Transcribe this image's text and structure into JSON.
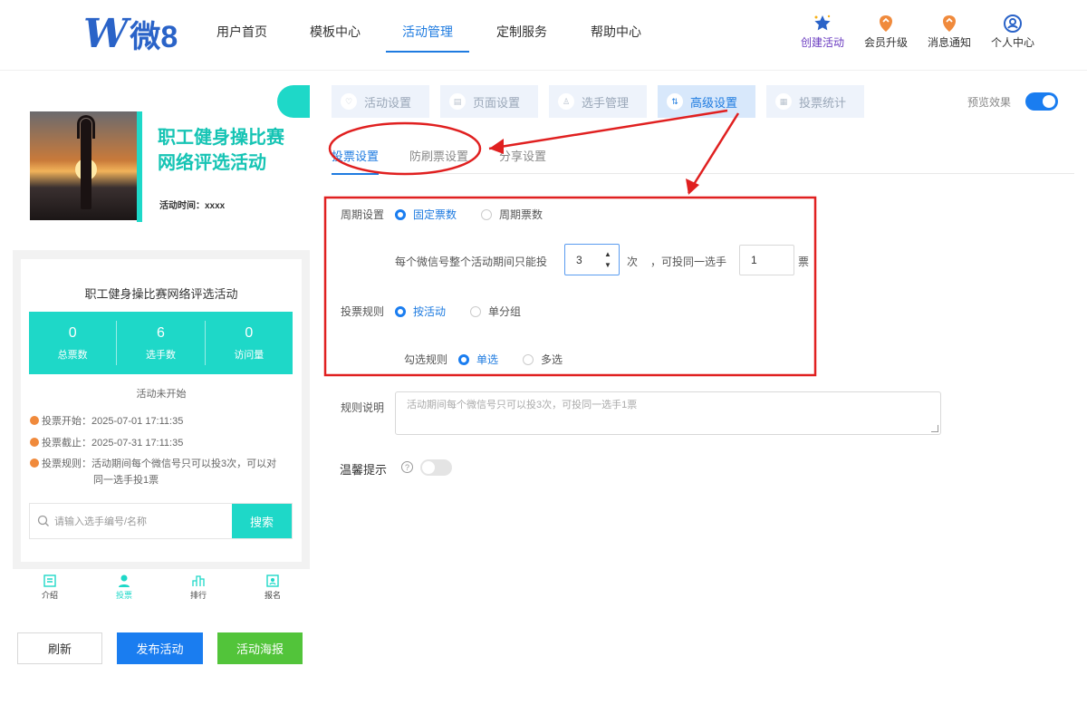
{
  "logo": {
    "mark": "W",
    "text": "微8"
  },
  "nav": {
    "items": [
      {
        "label": "用户首页"
      },
      {
        "label": "模板中心"
      },
      {
        "label": "活动管理"
      },
      {
        "label": "定制服务"
      },
      {
        "label": "帮助中心"
      }
    ],
    "active": "活动管理"
  },
  "header_icons": [
    {
      "label": "创建活动",
      "icon": "star-create-icon"
    },
    {
      "label": "会员升级",
      "icon": "member-upgrade-icon"
    },
    {
      "label": "消息通知",
      "icon": "notification-icon"
    },
    {
      "label": "个人中心",
      "icon": "user-center-icon"
    }
  ],
  "preview": {
    "banner_title_line1": "职工健身操比赛",
    "banner_title_line2": "网络评选活动",
    "activity_time": "活动时间：xxxx",
    "card_title": "职工健身操比赛网络评选活动",
    "stats": [
      {
        "value": "0",
        "label": "总票数"
      },
      {
        "value": "6",
        "label": "选手数"
      },
      {
        "value": "0",
        "label": "访问量"
      }
    ],
    "status": "活动未开始",
    "vote_start": "投票开始：2025-07-01 17:11:35",
    "vote_end": "投票截止：2025-07-31 17:11:35",
    "vote_rule_line1": "投票规则：活动期间每个微信号只可以投3次，可以对",
    "vote_rule_line2": "同一选手投1票",
    "search_placeholder": "请输入选手编号/名称",
    "search_button": "搜索",
    "tabbar": [
      {
        "label": "介绍",
        "icon": "intro-icon"
      },
      {
        "label": "投票",
        "icon": "vote-user-icon"
      },
      {
        "label": "排行",
        "icon": "ranking-icon"
      },
      {
        "label": "报名",
        "icon": "signup-icon"
      }
    ]
  },
  "actions": {
    "refresh": "刷新",
    "publish": "发布活动",
    "poster": "活动海报"
  },
  "top_tabs": [
    {
      "label": "活动设置",
      "icon": "heart-icon"
    },
    {
      "label": "页面设置",
      "icon": "page-icon"
    },
    {
      "label": "选手管理",
      "icon": "person-icon"
    },
    {
      "label": "高级设置",
      "icon": "settings-sliders-icon"
    },
    {
      "label": "投票统计",
      "icon": "stats-icon"
    }
  ],
  "active_top_tab": "高级设置",
  "preview_toggle": {
    "label": "预览效果",
    "on": true
  },
  "sub_tabs": [
    {
      "label": "投票设置"
    },
    {
      "label": "防刷票设置"
    },
    {
      "label": "分享设置"
    }
  ],
  "form": {
    "cycle_label": "周期设置",
    "cycle_options": [
      "固定票数",
      "周期票数"
    ],
    "cycle_selected": "固定票数",
    "limit_prefix": "每个微信号整个活动期间只能投",
    "limit_value": "3",
    "limit_unit": "次",
    "same_player_prefix": "，可投同一选手",
    "same_player_value": "1",
    "same_player_unit": "票",
    "rule_label": "投票规则",
    "rule_options": [
      "按活动",
      "单分组"
    ],
    "rule_selected": "按活动",
    "select_label": "勾选规则",
    "select_options": [
      "单选",
      "多选"
    ],
    "select_selected": "单选",
    "desc_label": "规则说明",
    "desc_placeholder": "活动期间每个微信号只可以投3次，可投同一选手1票",
    "tip_label": "温馨提示",
    "tip_help": "?",
    "tip_on": false
  },
  "colors": {
    "brand_blue": "#1e7be0",
    "teal": "#1ed8c8",
    "green": "#52c43a",
    "annotation_red": "#e02020"
  }
}
